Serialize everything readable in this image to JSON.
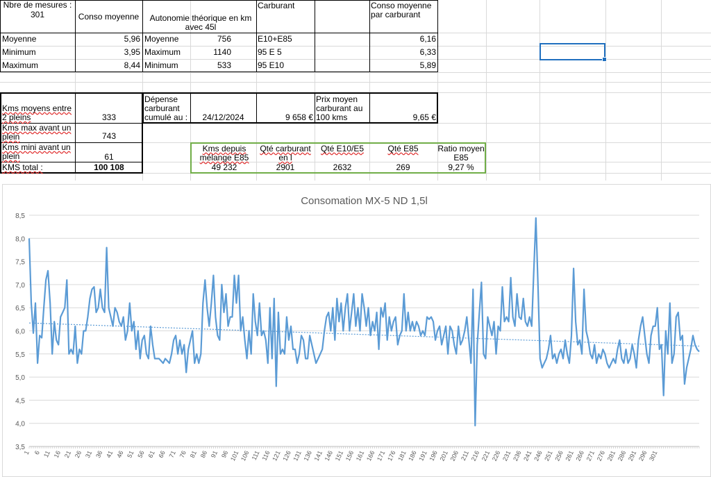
{
  "table1": {
    "measures_label": "Nbre de mesures :",
    "measures_value": "301",
    "conso_header": "Conso moyenne",
    "autonomie_header": "Autonomie théorique en km avec 45l",
    "rows": [
      {
        "label": "Moyenne",
        "conso": "5,96",
        "alabel": "Moyenne",
        "avalue": "756"
      },
      {
        "label": "Minimum",
        "conso": "3,95",
        "alabel": "Maximum",
        "avalue": "1140"
      },
      {
        "label": "Maximum",
        "conso": "8,44",
        "alabel": "Minimum",
        "avalue": "533"
      }
    ]
  },
  "table2": {
    "carburant_header": "Carburant",
    "conso_carb_header": "Conso moyenne par carburant",
    "rows": [
      {
        "fuel": "E10+E85",
        "value": "6,16"
      },
      {
        "fuel": "95 E 5",
        "value": "6,33"
      },
      {
        "fuel": "95 E10",
        "value": "5,89"
      }
    ]
  },
  "table3": {
    "kms_moyens_label": "Kms moyens entre 2 pleins",
    "kms_moyens_value": "333",
    "kms_max_label": "Kms max avant un plein",
    "kms_max_value": "743",
    "kms_mini_label": "Kms mini avant un plein",
    "kms_mini_value": "61",
    "kms_total_label": "KMS total :",
    "kms_total_value": "100 108"
  },
  "table4": {
    "depense_label": "Dépense carburant cumulé au :",
    "date": "24/12/2024",
    "amount": "9 658 €",
    "prix_label": "Prix moyen carburant au 100 kms",
    "prix_value": "9,65 €"
  },
  "table5": {
    "headers": [
      "Kms depuis mélange E85",
      "Qté carburant en l",
      "Qté E10/E5",
      "Qté E85",
      "Ratio moyen E85"
    ],
    "values": [
      "49 232",
      "2901",
      "2632",
      "269",
      "9,27 %"
    ]
  },
  "chart_data": {
    "type": "line",
    "title": "Consomation MX-5 ND 1,5l",
    "xlabel": "",
    "ylabel": "",
    "ylim": [
      3.5,
      8.5
    ],
    "yticks": [
      "3,5",
      "4,0",
      "4,5",
      "5,0",
      "5,5",
      "6,0",
      "6,5",
      "7,0",
      "7,5",
      "8,0",
      "8,5"
    ],
    "x_range": [
      1,
      301
    ],
    "x_tick_step": 5,
    "grid": true,
    "legend": "none",
    "trendline": {
      "type": "linear",
      "start": 6.17,
      "end": 5.67
    },
    "series": [
      {
        "color": "#5b9bd5",
        "values": [
          8.0,
          6.6,
          5.95,
          6.6,
          5.3,
          5.9,
          5.85,
          6.5,
          7.1,
          7.3,
          6.6,
          5.5,
          6.2,
          5.8,
          5.7,
          6.3,
          6.4,
          6.5,
          7.1,
          5.5,
          5.6,
          5.5,
          6.1,
          5.3,
          5.6,
          5.5,
          6.0,
          6.0,
          6.3,
          6.7,
          6.9,
          6.95,
          6.4,
          6.5,
          6.9,
          6.5,
          6.4,
          7.8,
          6.5,
          6.3,
          6.1,
          6.5,
          6.4,
          6.2,
          6.1,
          6.3,
          5.8,
          6.0,
          6.6,
          6.0,
          6.2,
          5.6,
          6.0,
          5.4,
          5.8,
          5.9,
          5.5,
          5.4,
          6.1,
          5.7,
          5.4,
          5.4,
          5.4,
          5.35,
          5.3,
          5.4,
          5.35,
          5.3,
          5.5,
          5.8,
          5.9,
          5.5,
          5.8,
          5.5,
          5.7,
          5.1,
          5.6,
          5.8,
          6.0,
          5.3,
          5.5,
          5.3,
          5.5,
          6.6,
          7.1,
          6.5,
          6.1,
          6.6,
          7.2,
          6.3,
          5.9,
          5.8,
          7.0,
          6.4,
          6.8,
          6.1,
          6.3,
          6.3,
          7.2,
          6.6,
          7.2,
          6.0,
          6.3,
          5.8,
          5.4,
          6.0,
          5.5,
          6.8,
          6.2,
          5.9,
          6.6,
          5.9,
          6.0,
          5.8,
          5.3,
          6.5,
          5.4,
          6.7,
          4.8,
          6.4,
          5.5,
          5.6,
          5.5,
          6.3,
          5.8,
          6.1,
          5.6,
          5.6,
          5.3,
          5.5,
          5.9,
          5.8,
          5.4,
          5.4,
          5.9,
          5.7,
          5.5,
          5.3,
          5.4,
          5.5,
          5.6,
          6.0,
          6.3,
          6.4,
          6.0,
          6.5,
          5.8,
          6.7,
          6.2,
          6.6,
          6.0,
          6.5,
          6.8,
          6.0,
          6.4,
          6.8,
          6.1,
          6.5,
          6.0,
          6.8,
          6.5,
          6.1,
          6.5,
          5.9,
          6.2,
          6.0,
          6.4,
          5.6,
          6.5,
          6.3,
          6.6,
          5.8,
          6.3,
          6.0,
          6.2,
          6.3,
          5.7,
          5.9,
          6.0,
          6.8,
          6.0,
          6.4,
          6.0,
          6.2,
          6.0,
          6.2,
          6.1,
          5.9,
          6.0,
          5.9,
          6.3,
          6.25,
          6.3,
          6.2,
          5.8,
          6.0,
          6.1,
          5.7,
          5.9,
          6.1,
          5.5,
          6.1,
          6.0,
          5.7,
          5.5,
          6.1,
          5.7,
          5.8,
          6.0,
          6.3,
          5.8,
          5.3,
          6.9,
          3.95,
          5.7,
          6.4,
          7.05,
          5.5,
          5.4,
          6.3,
          6.1,
          5.9,
          6.2,
          5.5,
          6.1,
          6.0,
          6.95,
          6.2,
          6.3,
          6.2,
          7.15,
          6.3,
          6.1,
          6.8,
          6.3,
          6.25,
          6.7,
          6.2,
          6.1,
          6.3,
          6.1,
          7.3,
          8.44,
          7.0,
          5.4,
          5.2,
          5.3,
          5.4,
          5.6,
          5.9,
          5.4,
          5.5,
          5.3,
          5.5,
          5.6,
          5.4,
          5.8,
          5.5,
          5.3,
          5.9,
          7.35,
          6.2,
          5.7,
          5.8,
          5.5,
          6.9,
          6.0,
          5.8,
          5.5,
          5.4,
          5.7,
          5.3,
          5.5,
          5.4,
          5.6,
          5.5,
          5.3,
          5.2,
          5.3,
          5.4,
          5.3,
          5.6,
          5.8,
          5.4,
          5.3,
          5.6,
          5.3,
          5.4,
          5.7,
          5.5,
          5.2,
          5.8,
          6.1,
          6.3,
          5.9,
          5.5,
          5.3,
          5.9,
          6.1,
          6.1,
          6.5,
          5.6,
          5.7,
          4.6,
          6.0,
          5.5,
          6.6,
          5.3,
          5.5,
          6.3,
          6.4,
          5.8,
          5.9,
          4.85,
          5.2,
          5.4,
          5.6,
          5.9,
          5.7,
          5.6,
          5.55
        ]
      }
    ]
  }
}
